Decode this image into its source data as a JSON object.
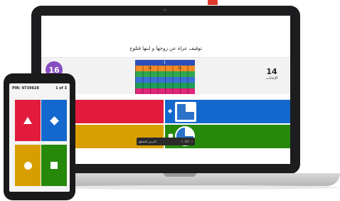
{
  "question": {
    "title": "توقيف عراة عن زوجها و ابنها فتلوح",
    "timer": "16",
    "answers_count": "14",
    "answers_label": "الإجابات"
  },
  "fraction_image": {
    "labels": [
      "1",
      "½",
      "⅓",
      "¼",
      "⅕",
      "⅙"
    ]
  },
  "answer_tiles": [
    {
      "shape": "triangle",
      "shape_icon": "▲",
      "color": "#e21b3c"
    },
    {
      "shape": "diamond",
      "shape_icon": "◆",
      "color": "#1368ce"
    },
    {
      "shape": "circle",
      "shape_icon": "●",
      "color": "#d89e00"
    },
    {
      "shape": "square",
      "shape_icon": "■",
      "color": "#26890c"
    }
  ],
  "player_controls": {
    "label": "الدرس المقطع",
    "page": "1/1",
    "prev": "‹",
    "next": "›"
  },
  "phone": {
    "pin_label": "PIN: 9739828",
    "progress": "1 of 3"
  },
  "colors": {
    "red": "#e21b3c",
    "blue": "#1368ce",
    "yellow": "#d89e00",
    "green": "#26890c",
    "purple": "#864cbf"
  }
}
